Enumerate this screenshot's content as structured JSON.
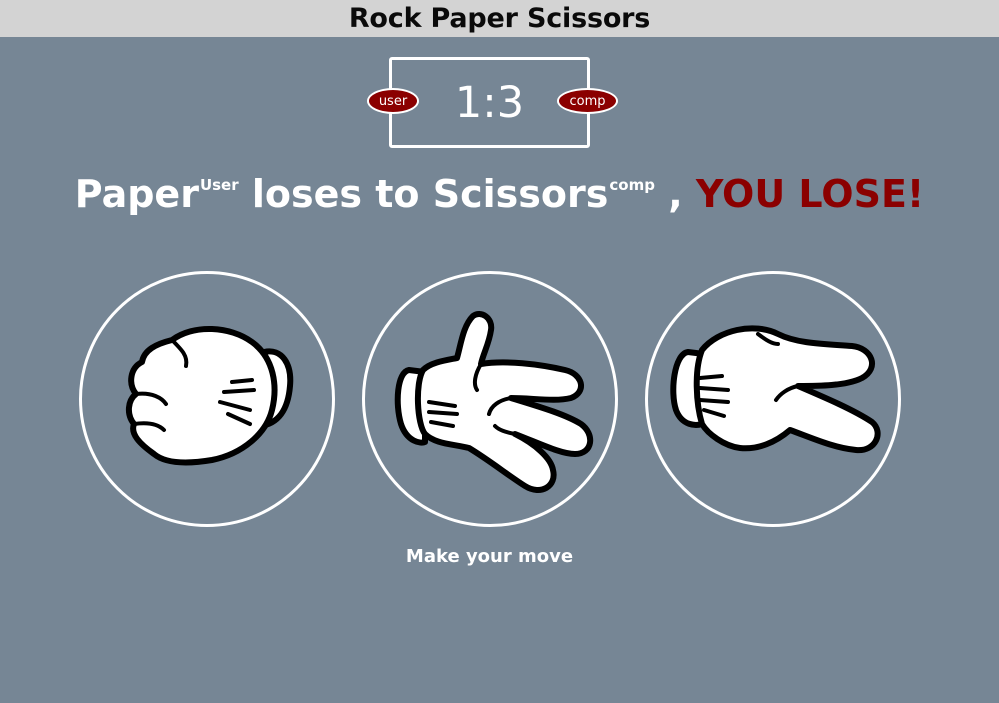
{
  "app": {
    "title": "Rock Paper Scissors"
  },
  "scoreboard": {
    "score": "1:3",
    "user_badge": "user",
    "comp_badge": "comp"
  },
  "result": {
    "user_choice": "Paper",
    "user_tag": "User",
    "middle_text": "loses to",
    "comp_choice": "Scissors",
    "comp_tag": "comp",
    "separator": ",",
    "outcome": "YOU LOSE!"
  },
  "choices": [
    {
      "name": "rock",
      "icon": "fist-glove-icon"
    },
    {
      "name": "paper",
      "icon": "open-hand-glove-icon"
    },
    {
      "name": "scissors",
      "icon": "two-fingers-glove-icon"
    }
  ],
  "prompt": "Make your move",
  "colors": {
    "background": "#768695",
    "header": "#d3d3d3",
    "accent": "#8b0000",
    "foreground": "#ffffff"
  }
}
